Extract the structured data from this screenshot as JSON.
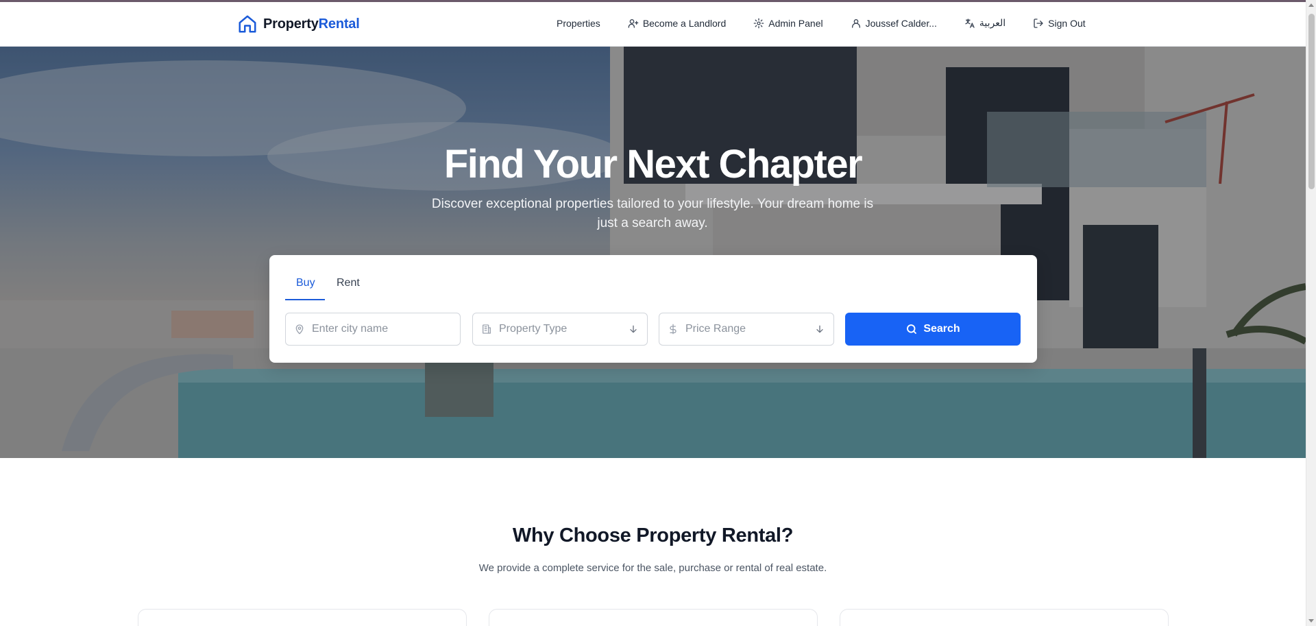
{
  "header": {
    "logo_part1": "Property",
    "logo_part2": "Rental",
    "nav": {
      "properties": "Properties",
      "become_landlord": "Become a Landlord",
      "admin_panel": "Admin Panel",
      "user": "Joussef Calder...",
      "language": "العربية",
      "sign_out": "Sign Out"
    }
  },
  "hero": {
    "title": "Find Your Next Chapter",
    "subtitle": "Discover exceptional properties tailored to your lifestyle. Your dream home is just a search away."
  },
  "search": {
    "tabs": {
      "buy": "Buy",
      "rent": "Rent"
    },
    "active_tab": "Buy",
    "city_placeholder": "Enter city name",
    "property_type": "Property Type",
    "price_range": "Price Range",
    "button": "Search"
  },
  "why": {
    "title": "Why Choose Property Rental?",
    "subtitle": "We provide a complete service for the sale, purchase or rental of real estate."
  },
  "colors": {
    "brand": "#1b5bd9",
    "button": "#1863f5"
  },
  "icons": {
    "logo": "home-icon",
    "become_landlord": "user-plus-icon",
    "admin_panel": "gear-icon",
    "user": "user-icon",
    "language": "translate-icon",
    "sign_out": "log-out-icon",
    "city": "map-pin-icon",
    "property_type": "building-icon",
    "price_range": "dollar-icon",
    "search": "search-icon"
  }
}
